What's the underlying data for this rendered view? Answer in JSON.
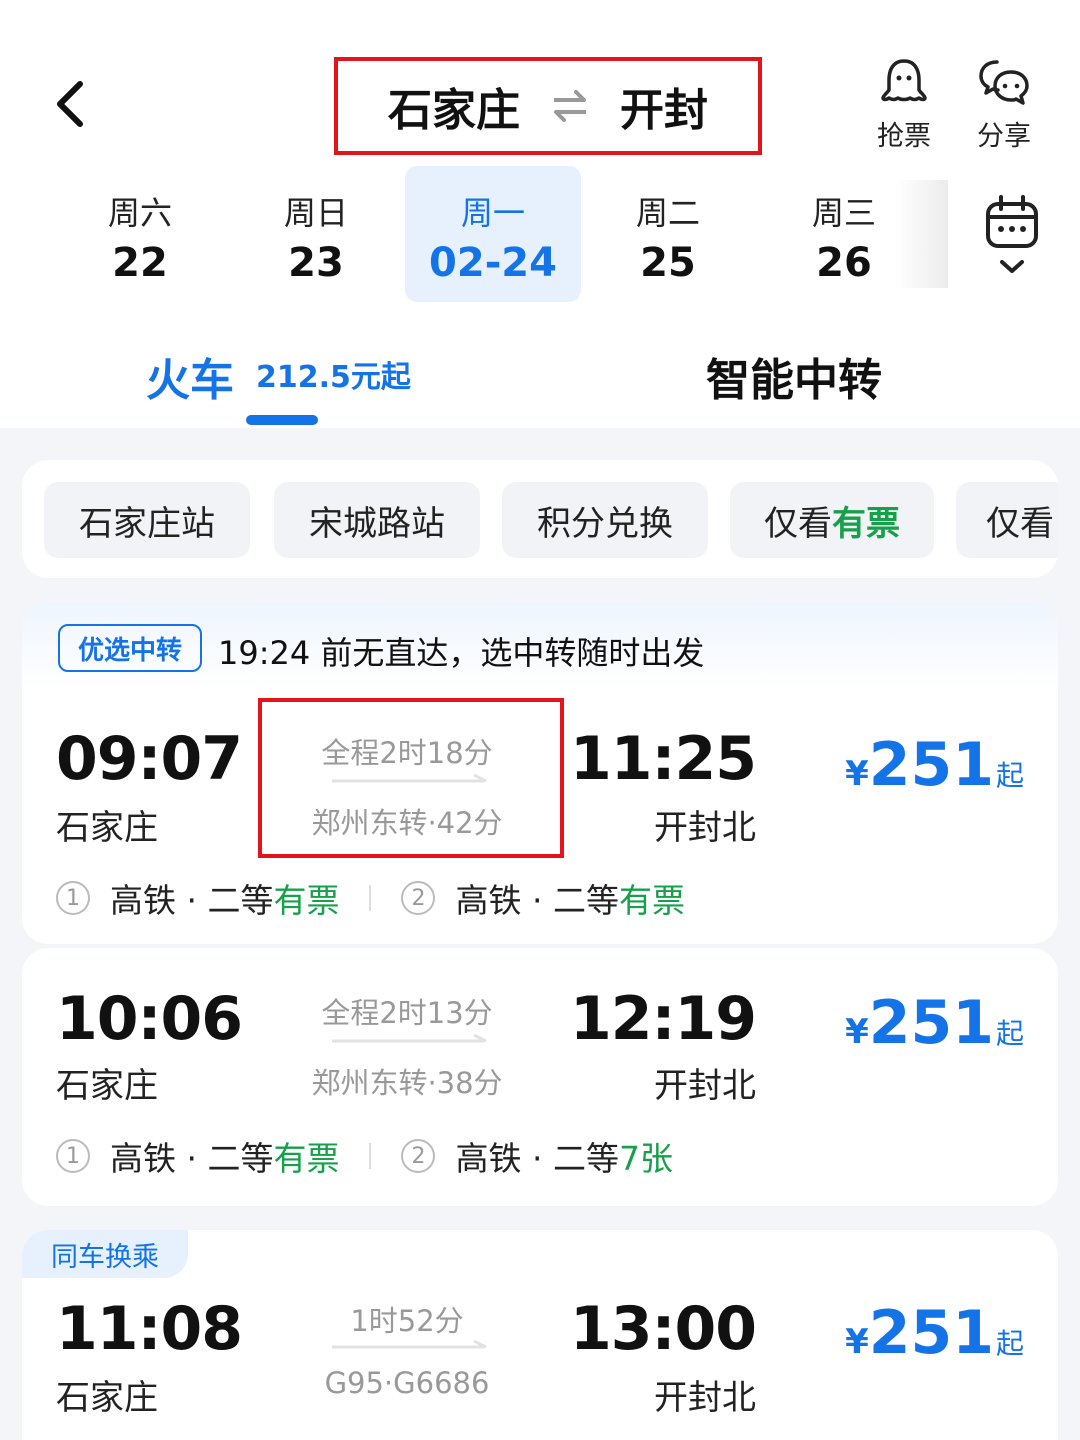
{
  "header": {
    "from": "石家庄",
    "to": "开封",
    "grab_ticket_label": "抢票",
    "share_label": "分享"
  },
  "dates": [
    {
      "weekday": "周六",
      "date": "22",
      "active": false
    },
    {
      "weekday": "周日",
      "date": "23",
      "active": false
    },
    {
      "weekday": "周一",
      "date": "02-24",
      "active": true
    },
    {
      "weekday": "周二",
      "date": "25",
      "active": false
    },
    {
      "weekday": "周三",
      "date": "26",
      "active": false
    }
  ],
  "modes": {
    "train_label": "火车",
    "train_price": "212.5元起",
    "transfer_label": "智能中转"
  },
  "filters": {
    "station1": "石家庄站",
    "station2": "宋城路站",
    "points": "积分兑换",
    "only_prefix": "仅看",
    "only_highlight": "有票",
    "only_cut": "仅看"
  },
  "promo": {
    "badge": "优选中转",
    "text": "19:24 前无直达，选中转随时出发"
  },
  "trains": [
    {
      "dep_time": "09:07",
      "dep_station": "石家庄",
      "duration": "全程2时18分",
      "via": "郑州东转·42分",
      "arr_time": "11:25",
      "arr_station": "开封北",
      "currency": "¥",
      "price": "251",
      "price_suffix": "起",
      "leg1_num": "1",
      "leg1_type": "高铁 · 二等",
      "leg1_status": "有票",
      "leg2_num": "2",
      "leg2_type": "高铁 · 二等",
      "leg2_status": "有票"
    },
    {
      "dep_time": "10:06",
      "dep_station": "石家庄",
      "duration": "全程2时13分",
      "via": "郑州东转·38分",
      "arr_time": "12:19",
      "arr_station": "开封北",
      "currency": "¥",
      "price": "251",
      "price_suffix": "起",
      "leg1_num": "1",
      "leg1_type": "高铁 · 二等",
      "leg1_status": "有票",
      "leg2_num": "2",
      "leg2_type": "高铁 · 二等",
      "leg2_status": "7张"
    },
    {
      "tag": "同车换乘",
      "dep_time": "11:08",
      "dep_station": "石家庄",
      "duration": "1时52分",
      "via": "G95·G6686",
      "arr_time": "13:00",
      "arr_station": "开封北",
      "currency": "¥",
      "price": "251",
      "price_suffix": "起"
    }
  ],
  "colors": {
    "accent": "#1473e6",
    "available": "#16a04a",
    "highlight_box": "#e3141b"
  }
}
